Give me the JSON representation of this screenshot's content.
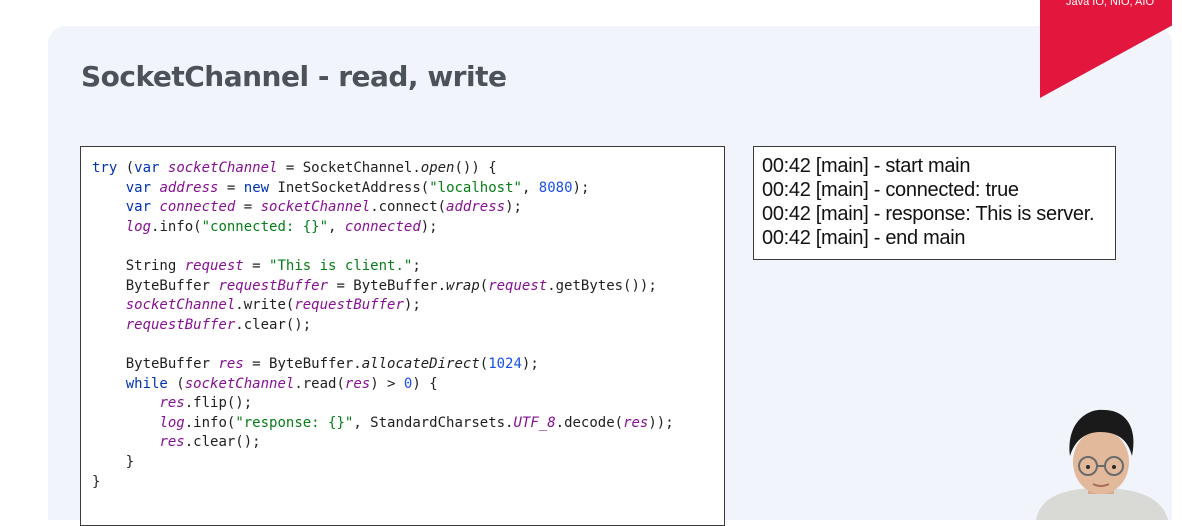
{
  "slide": {
    "title": "SocketChannel - read, write",
    "corner_label": "Java IO, NIO, AIO",
    "accent_color": "#e3173e",
    "background_color": "#f1f4fb"
  },
  "code": {
    "language": "java",
    "lines": [
      "try (var socketChannel = SocketChannel.open()) {",
      "    var address = new InetSocketAddress(\"localhost\", 8080);",
      "    var connected = socketChannel.connect(address);",
      "    log.info(\"connected: {}\", connected);",
      "",
      "    String request = \"This is client.\";",
      "    ByteBuffer requestBuffer = ByteBuffer.wrap(request.getBytes());",
      "    socketChannel.write(requestBuffer);",
      "    requestBuffer.clear();",
      "",
      "    ByteBuffer res = ByteBuffer.allocateDirect(1024);",
      "    while (socketChannel.read(res) > 0) {",
      "        res.flip();",
      "        log.info(\"response: {}\", StandardCharsets.UTF_8.decode(res));",
      "        res.clear();",
      "    }",
      "}"
    ]
  },
  "output": {
    "lines": [
      "00:42 [main] - start main",
      "00:42 [main] - connected: true",
      "00:42 [main] - response: This is server.",
      "00:42 [main] - end main"
    ]
  },
  "presenter": {
    "icon": "presenter-avatar"
  }
}
